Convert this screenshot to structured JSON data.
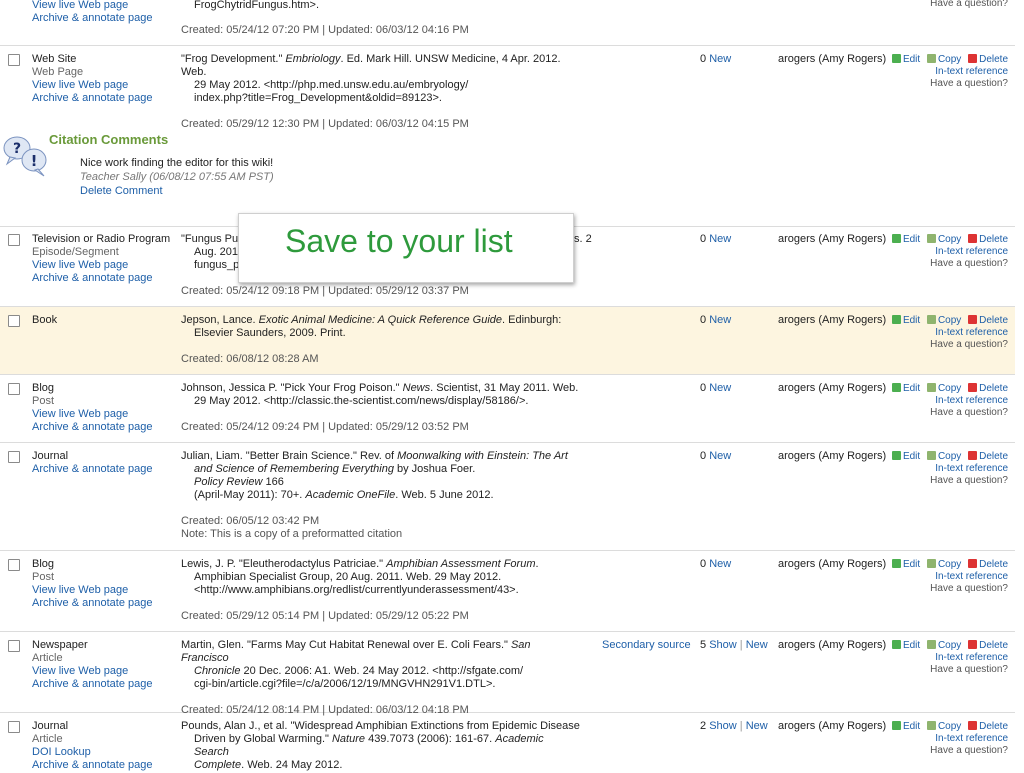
{
  "rows": [
    {
      "source": [
        "View live Web page",
        "Archive & annotate page"
      ],
      "citation": [
        "FrogChytridFungus.htm>."
      ],
      "meta": [
        "Created: 05/24/12 07:20 PM | Updated: 06/03/12 04:16 PM"
      ],
      "actions_q": "Have a question?"
    },
    {
      "type": "Web Site",
      "subtype": "Web Page",
      "links": [
        "View live Web page",
        "Archive & annotate page"
      ],
      "citation_html": [
        "\"Frog Development.\" <i>Embriology</i>. Ed. Mark Hill. UNSW Medicine, 4 Apr. 2012. Web.",
        "29 May 2012. <http://php.med.unsw.edu.au/embryology/",
        "index.php?title=Frog_Development&oldid=89123>."
      ],
      "meta": [
        "Created: 05/29/12 12:30 PM | Updated: 06/03/12 04:15 PM"
      ],
      "notes_count": "0",
      "notes_new": "New",
      "user": "arogers (Amy Rogers)"
    },
    {
      "type": "Television or Radio Program",
      "subtype": "Episode/Segment",
      "links": [
        "View live Web page",
        "Archive & annotate page"
      ],
      "citation_html": [
        "\"Fungus Pus",
        "Aug. 201",
        "fungus_p"
      ],
      "citation_tail": "s. 2",
      "meta": [
        "Created: 05/24/12 09:18 PM | Updated: 05/29/12 03:37 PM"
      ],
      "notes_count": "0",
      "notes_new": "New",
      "user": "arogers (Amy Rogers)"
    },
    {
      "type": "Book",
      "subtype": "",
      "links": [],
      "citation_html": [
        "Jepson, Lance. <i>Exotic Animal Medicine: A Quick Reference Guide</i>. Edinburgh:",
        "Elsevier Saunders, 2009. Print."
      ],
      "meta": [
        "Created: 06/08/12 08:28 AM"
      ],
      "notes_count": "0",
      "notes_new": "New",
      "user": "arogers (Amy Rogers)"
    },
    {
      "type": "Blog",
      "subtype": "Post",
      "links": [
        "View live Web page",
        "Archive & annotate page"
      ],
      "citation_html": [
        "Johnson, Jessica P. \"Pick Your Frog Poison.\" <i>News</i>. Scientist, 31 May 2011. Web.",
        "29 May 2012. <http://classic.the-scientist.com/news/display/58186/>."
      ],
      "meta": [
        "Created: 05/24/12 09:24 PM | Updated: 05/29/12 03:52 PM"
      ],
      "notes_count": "0",
      "notes_new": "New",
      "user": "arogers (Amy Rogers)"
    },
    {
      "type": "Journal",
      "subtype": "",
      "links": [
        "Archive & annotate page"
      ],
      "citation_html": [
        "Julian, Liam. \"Better Brain Science.\" Rev. of <i>Moonwalking with Einstein: The Art</i>",
        "<i>and Science of Remembering Everything</i> by Joshua Foer.",
        "<i>Policy Review</i> 166",
        "(April-May 2011): 70+. <i>Academic OneFile</i>. Web. 5 June 2012."
      ],
      "meta": [
        "Created: 06/05/12 03:42 PM",
        "Note: This is a copy of a preformatted citation"
      ],
      "notes_count": "0",
      "notes_new": "New",
      "user": "arogers (Amy Rogers)"
    },
    {
      "type": "Blog",
      "subtype": "Post",
      "links": [
        "View live Web page",
        "Archive & annotate page"
      ],
      "citation_html": [
        "Lewis, J. P. \"Eleutherodactylus Patriciae.\" <i>Amphibian Assessment Forum</i>.",
        "Amphibian Specialist Group, 20 Aug. 2011. Web. 29 May 2012.",
        "<http://www.amphibians.org/redlist/currentlyunderassessment/43>."
      ],
      "meta": [
        "Created: 05/29/12 05:14 PM | Updated: 05/29/12 05:22 PM"
      ],
      "notes_count": "0",
      "notes_new": "New",
      "user": "arogers (Amy Rogers)"
    },
    {
      "type": "Newspaper",
      "subtype": "Article",
      "links": [
        "View live Web page",
        "Archive & annotate page"
      ],
      "citation_html": [
        "Martin, Glen. \"Farms May Cut Habitat Renewal over E. Coli Fears.\" <i>San Francisco</i>",
        "<i>Chronicle</i> 20 Dec. 2006: A1. Web. 24 May 2012. <http://sfgate.com/",
        "cgi-bin/article.cgi?file=/c/a/2006/12/19/MNGVHN291V1.DTL>."
      ],
      "meta": [
        "Created: 05/24/12 08:14 PM | Updated: 06/03/12 04:18 PM"
      ],
      "secondary": "Secondary source",
      "notes_count": "5",
      "notes_show": "Show",
      "notes_new": "New",
      "user": "arogers (Amy Rogers)"
    },
    {
      "type": "Journal",
      "subtype": "Article",
      "links": [
        "DOI Lookup",
        "Archive & annotate page"
      ],
      "citation_html": [
        "Pounds, Alan J., et al. \"Widespread Amphibian Extinctions from Epidemic Disease",
        "Driven by Global Warming.\" <i>Nature</i> 439.7073 (2006): 161-67. <i>Academic Search</i>",
        "<i>Complete</i>. Web. 24 May 2012."
      ],
      "meta": [],
      "notes_count": "2",
      "notes_show": "Show",
      "notes_new": "New",
      "user": "arogers (Amy Rogers)"
    }
  ],
  "actions": {
    "edit": "Edit",
    "copy": "Copy",
    "delete": "Delete",
    "intext": "In-text reference",
    "question": "Have a question?"
  },
  "comments": {
    "title": "Citation Comments",
    "text": "Nice work finding the editor for this wiki!",
    "author": "Teacher Sally (06/08/12 07:55 AM PST)",
    "delete_label": "Delete Comment"
  },
  "popup": {
    "text": "Save to your list"
  },
  "colors": {
    "accent_green": "#2e9a3c",
    "link_blue": "#1e5fa8",
    "highlight_row": "#fdf5e0"
  }
}
